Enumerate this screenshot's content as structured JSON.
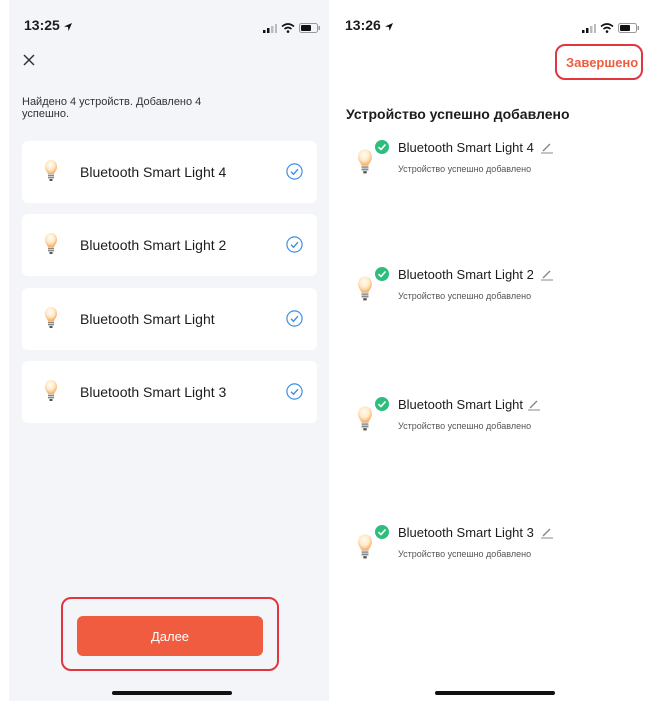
{
  "left_screen": {
    "status_time": "13:25",
    "summary": "Найдено 4 устройств. Добавлено 4 успешно.",
    "devices": [
      {
        "name": "Bluetooth Smart Light 4"
      },
      {
        "name": "Bluetooth Smart Light 2"
      },
      {
        "name": "Bluetooth Smart Light"
      },
      {
        "name": "Bluetooth Smart Light 3"
      }
    ],
    "next_button": "Далее"
  },
  "right_screen": {
    "status_time": "13:26",
    "done_button": "Завершено",
    "heading": "Устройство успешно добавлено",
    "devices": [
      {
        "name": "Bluetooth Smart Light 4",
        "status": "Устройство успешно добавлено"
      },
      {
        "name": "Bluetooth Smart Light 2",
        "status": "Устройство успешно добавлено"
      },
      {
        "name": "Bluetooth Smart Light",
        "status": "Устройство успешно добавлено"
      },
      {
        "name": "Bluetooth Smart Light 3",
        "status": "Устройство успешно добавлено"
      }
    ]
  },
  "colors": {
    "accent": "#ef5c3f",
    "highlight": "#e2363f",
    "success": "#2dbd7c",
    "check": "#3a8ee6"
  },
  "icons": [
    "location-arrow-icon",
    "signal-icon",
    "wifi-icon",
    "battery-icon",
    "close-icon",
    "bulb-icon",
    "check-circle-icon",
    "pencil-icon"
  ]
}
